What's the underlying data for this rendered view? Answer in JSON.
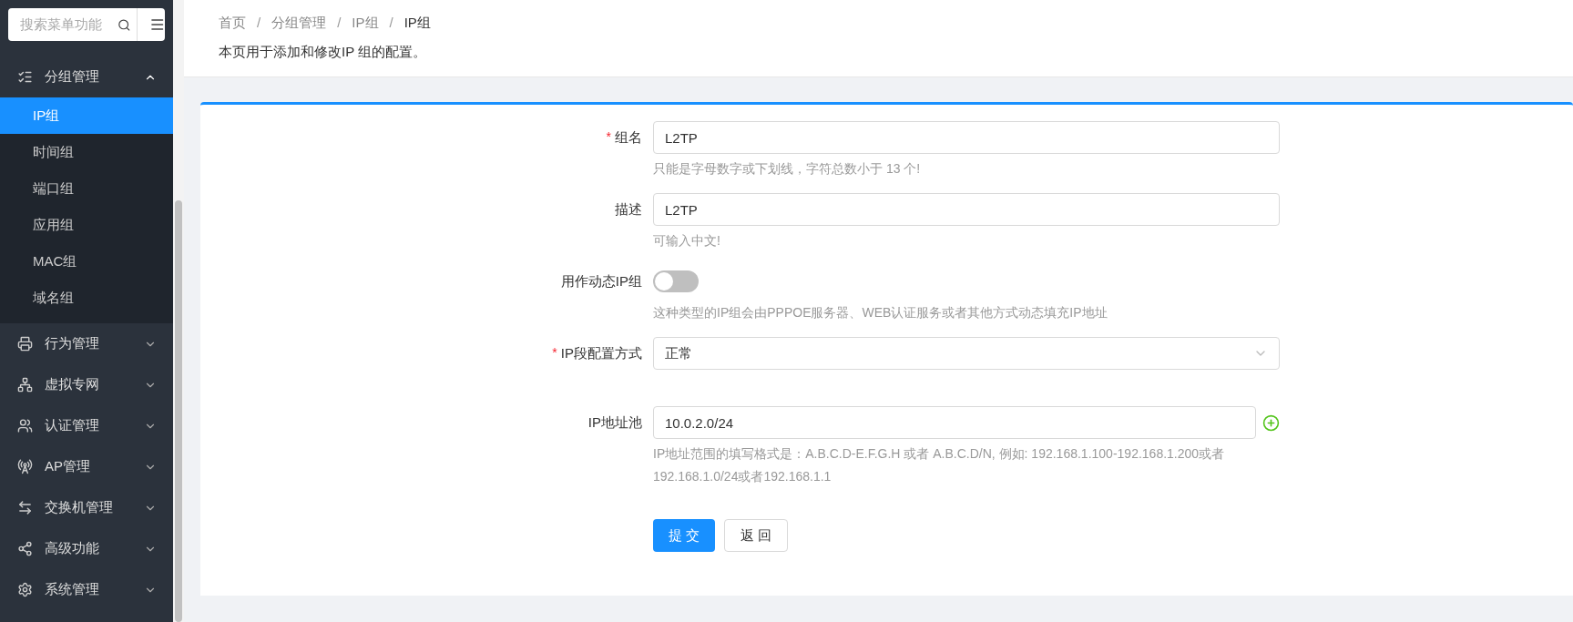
{
  "sidebar": {
    "search": {
      "placeholder": "搜索菜单功能"
    },
    "menu": [
      {
        "label": "分组管理",
        "expanded": true,
        "children": [
          {
            "label": "IP组",
            "selected": true
          },
          {
            "label": "时间组",
            "selected": false
          },
          {
            "label": "端口组",
            "selected": false
          },
          {
            "label": "应用组",
            "selected": false
          },
          {
            "label": "MAC组",
            "selected": false
          },
          {
            "label": "域名组",
            "selected": false
          }
        ]
      },
      {
        "label": "行为管理",
        "expanded": false
      },
      {
        "label": "虚拟专网",
        "expanded": false
      },
      {
        "label": "认证管理",
        "expanded": false
      },
      {
        "label": "AP管理",
        "expanded": false
      },
      {
        "label": "交换机管理",
        "expanded": false
      },
      {
        "label": "高级功能",
        "expanded": false
      },
      {
        "label": "系统管理",
        "expanded": false
      }
    ]
  },
  "header": {
    "breadcrumb": [
      "首页",
      "分组管理",
      "IP组",
      "IP组"
    ],
    "separator": "/",
    "description": "本页用于添加和修改IP 组的配置。"
  },
  "form": {
    "required_mark": "*",
    "fields": [
      {
        "kind": "text",
        "label": "组名",
        "required": true,
        "value": "L2TP",
        "help": "只能是字母数字或下划线，字符总数小于 13 个!"
      },
      {
        "kind": "text",
        "label": "描述",
        "required": false,
        "value": "L2TP",
        "help": "可输入中文!"
      },
      {
        "kind": "switch",
        "label": "用作动态IP组",
        "required": false,
        "on": false,
        "help": "这种类型的IP组会由PPPOE服务器、WEB认证服务或者其他方式动态填充IP地址"
      },
      {
        "kind": "select",
        "label": "IP段配置方式",
        "required": true,
        "value": "正常"
      },
      {
        "kind": "pool",
        "label": "IP地址池",
        "required": false,
        "value": "10.0.2.0/24",
        "help": "IP地址范围的填写格式是：A.B.C.D-E.F.G.H 或者 A.B.C.D/N, 例如: 192.168.1.100-192.168.1.200或者192.168.1.0/24或者192.168.1.1"
      }
    ],
    "buttons": [
      {
        "label": "提 交",
        "kind": "primary"
      },
      {
        "label": "返 回",
        "kind": "default"
      }
    ]
  }
}
